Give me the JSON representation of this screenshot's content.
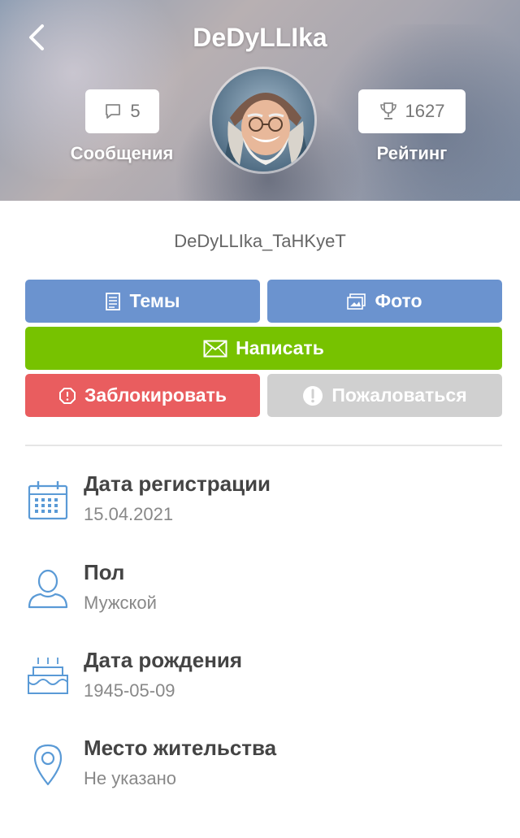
{
  "header": {
    "title": "DeDyLLIka",
    "messages": {
      "count": "5",
      "label": "Сообщения"
    },
    "rating": {
      "value": "1627",
      "label": "Рейтинг"
    }
  },
  "profile": {
    "username": "DeDyLLIka_TaHKyeT"
  },
  "actions": {
    "topics": "Темы",
    "photo": "Фото",
    "write": "Написать",
    "block": "Заблокировать",
    "report": "Пожаловаться"
  },
  "info": {
    "registration": {
      "label": "Дата регистрации",
      "value": "15.04.2021"
    },
    "gender": {
      "label": "Пол",
      "value": "Мужской"
    },
    "birthday": {
      "label": "Дата рождения",
      "value": "1945-05-09"
    },
    "location": {
      "label": "Место жительства",
      "value": "Не указано"
    }
  },
  "colors": {
    "blue": "#6b93cf",
    "green": "#77c200",
    "red": "#e95d5f",
    "gray": "#d0d0d0",
    "icon": "#5a9ad6"
  }
}
